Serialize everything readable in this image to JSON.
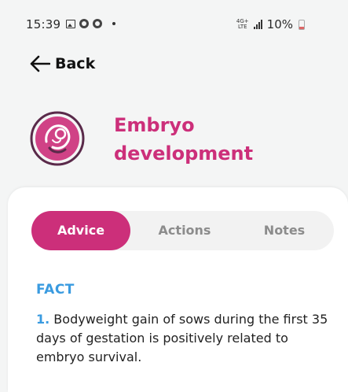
{
  "status_bar": {
    "time": "15:39",
    "network_top": "4G+",
    "network_bottom": "LTE",
    "battery": "10%"
  },
  "nav": {
    "back_label": "Back"
  },
  "header": {
    "title_line1": "Embryo",
    "title_line2": "development",
    "icon": "embryo-icon",
    "accent_color": "#cc2f7a"
  },
  "tabs": [
    {
      "label": "Advice",
      "active": true
    },
    {
      "label": "Actions",
      "active": false
    },
    {
      "label": "Notes",
      "active": false
    }
  ],
  "content": {
    "section_heading": "FACT",
    "fact_number": "1.",
    "fact_text": " Bodyweight gain of sows during the first 35 days of gestation is positively related to embryo survival.",
    "heading_color": "#3a9be0"
  }
}
